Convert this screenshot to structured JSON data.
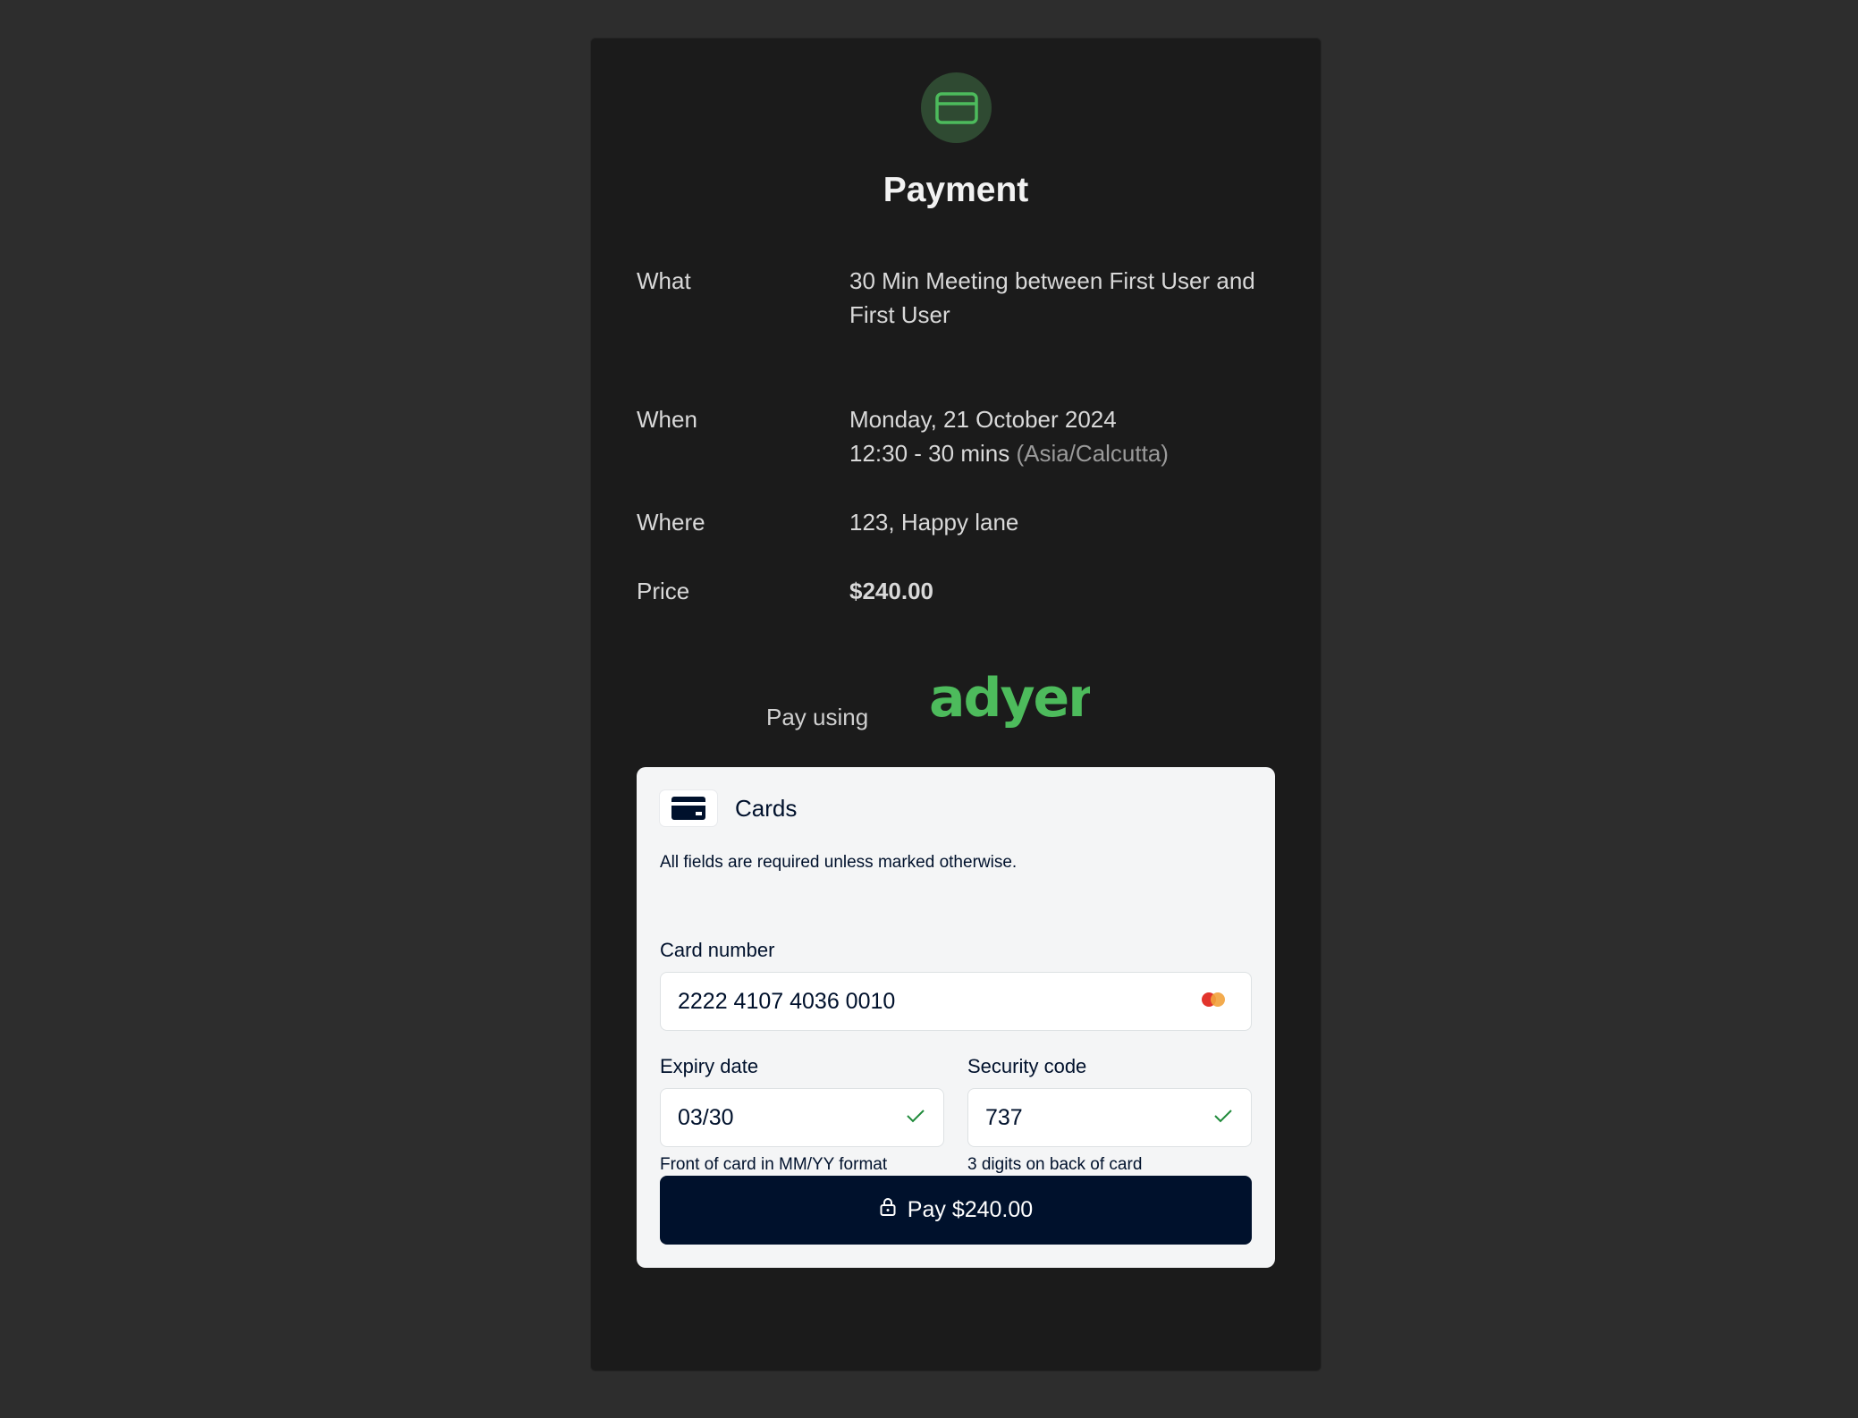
{
  "page": {
    "title": "Payment"
  },
  "details": [
    {
      "label": "What",
      "value": "30 Min Meeting between First User and First User"
    },
    {
      "label": "When",
      "date": "Monday, 21 October 2024",
      "time": "12:30 - 30 mins",
      "timezone": "(Asia/Calcutta)"
    },
    {
      "label": "Where",
      "value": "123, Happy lane"
    },
    {
      "label": "Price",
      "value": "$240.00"
    }
  ],
  "provider": {
    "pay_using_label": "Pay using",
    "logo_text": "adyen",
    "logo_color": "#4dbb5c"
  },
  "card_form": {
    "method_label": "Cards",
    "required_note": "All fields are required unless marked otherwise.",
    "card_number": {
      "label": "Card number",
      "value": "2222 4107 4036 0010"
    },
    "expiry": {
      "label": "Expiry date",
      "value": "03/30",
      "helper": "Front of card in MM/YY format"
    },
    "security": {
      "label": "Security code",
      "value": "737",
      "helper": "3 digits on back of card"
    },
    "pay_button": "Pay $240.00"
  },
  "colors": {
    "accent_green": "#4dbb5c",
    "button_navy": "#00112c"
  }
}
